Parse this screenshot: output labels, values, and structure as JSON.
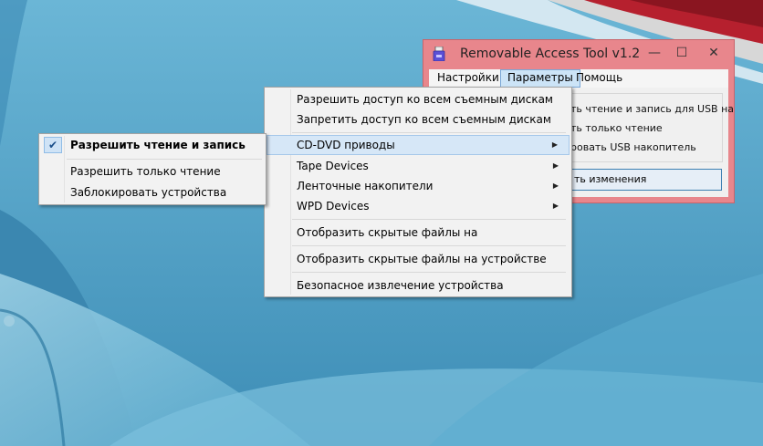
{
  "window": {
    "title": "Removable Access Tool v1.2",
    "minimize_glyph": "—",
    "maximize_glyph": "☐",
    "close_glyph": "✕"
  },
  "menubar": {
    "items": [
      {
        "label": "Настройки"
      },
      {
        "label": "Параметры"
      },
      {
        "label": "Помощь"
      }
    ]
  },
  "options": {
    "rw_usb": "ть чтение и запись для USB на",
    "readonly": "ть только чтение",
    "block_usb": "ровать USB накопитель"
  },
  "apply_button": {
    "label": "ть изменения"
  },
  "params_menu": {
    "items": [
      {
        "label": "Разрешить доступ ко всем съемным дискам"
      },
      {
        "label": "Запретить доступ ко всем съемным дискам"
      },
      {
        "label": "CD-DVD приводы"
      },
      {
        "label": "Tape Devices"
      },
      {
        "label": "Ленточные накопители"
      },
      {
        "label": "WPD Devices"
      },
      {
        "label": "Отобразить скрытые файлы на"
      },
      {
        "label": "Отобразить скрытые файлы на устройстве"
      },
      {
        "label": "Безопасное извлечение устройства"
      }
    ],
    "arrow_glyph": "▶"
  },
  "cd_submenu": {
    "items": [
      {
        "label": "Разрешить чтение и запись"
      },
      {
        "label": "Разрешить только чтение"
      },
      {
        "label": "Заблокировать устройства"
      }
    ],
    "check_glyph": "✔"
  },
  "colors": {
    "window_frame": "#e8868c",
    "menu_highlight": "#d6e7f7",
    "desktop": "#4b9cc2"
  }
}
